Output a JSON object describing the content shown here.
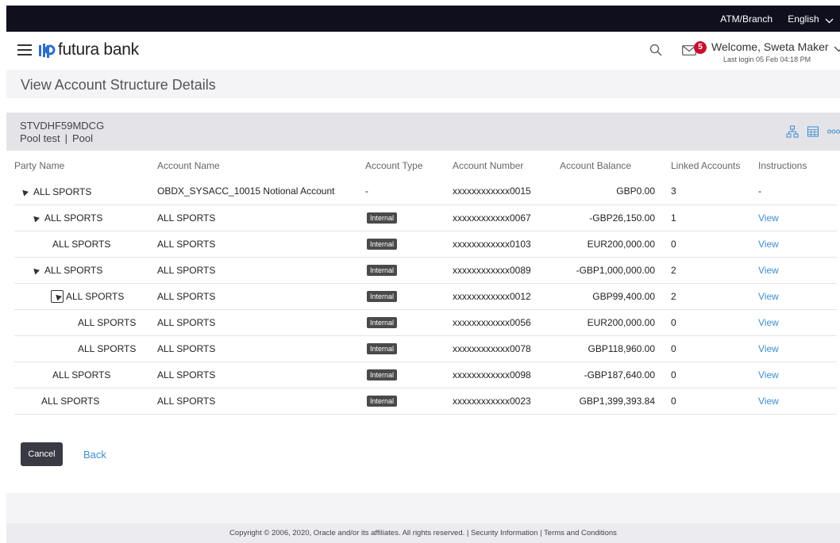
{
  "topbar": {
    "atm_branch": "ATM/Branch",
    "language": "English"
  },
  "header": {
    "logo_text": "futura bank",
    "notification_count": "5",
    "welcome": "Welcome, Sweta Maker",
    "last_login": "Last login 05 Feb 04:18 PM"
  },
  "page": {
    "title": "View Account Structure Details"
  },
  "structure": {
    "id": "STVDHF59MDCG",
    "name": "Pool test",
    "type": "Pool"
  },
  "columns": {
    "party": "Party Name",
    "account_name": "Account Name",
    "account_type": "Account Type",
    "account_number": "Account Number",
    "balance": "Account Balance",
    "linked": "Linked Accounts",
    "instructions": "Instructions"
  },
  "rows": [
    {
      "party": "ALL SPORTS",
      "account_name": "OBDX_SYSACC_10015 Notional Account",
      "type": "-",
      "number": "xxxxxxxxxxxx0015",
      "balance": "GBP0.00",
      "linked": "3",
      "instructions": "-"
    },
    {
      "party": "ALL SPORTS",
      "account_name": "ALL SPORTS",
      "type": "Internal",
      "number": "xxxxxxxxxxxx0067",
      "balance": "-GBP26,150.00",
      "linked": "1",
      "instructions": "View"
    },
    {
      "party": "ALL SPORTS",
      "account_name": "ALL SPORTS",
      "type": "Internal",
      "number": "xxxxxxxxxxxx0103",
      "balance": "EUR200,000.00",
      "linked": "0",
      "instructions": "View"
    },
    {
      "party": "ALL SPORTS",
      "account_name": "ALL SPORTS",
      "type": "Internal",
      "number": "xxxxxxxxxxxx0089",
      "balance": "-GBP1,000,000.00",
      "linked": "2",
      "instructions": "View"
    },
    {
      "party": "ALL SPORTS",
      "account_name": "ALL SPORTS",
      "type": "Internal",
      "number": "xxxxxxxxxxxx0012",
      "balance": "GBP99,400.00",
      "linked": "2",
      "instructions": "View"
    },
    {
      "party": "ALL SPORTS",
      "account_name": "ALL SPORTS",
      "type": "Internal",
      "number": "xxxxxxxxxxxx0056",
      "balance": "EUR200,000.00",
      "linked": "0",
      "instructions": "View"
    },
    {
      "party": "ALL SPORTS",
      "account_name": "ALL SPORTS",
      "type": "Internal",
      "number": "xxxxxxxxxxxx0078",
      "balance": "GBP118,960.00",
      "linked": "0",
      "instructions": "View"
    },
    {
      "party": "ALL SPORTS",
      "account_name": "ALL SPORTS",
      "type": "Internal",
      "number": "xxxxxxxxxxxx0098",
      "balance": "-GBP187,640.00",
      "linked": "0",
      "instructions": "View"
    },
    {
      "party": "ALL SPORTS",
      "account_name": "ALL SPORTS",
      "type": "Internal",
      "number": "xxxxxxxxxxxx0023",
      "balance": "GBP1,399,393.84",
      "linked": "0",
      "instructions": "View"
    }
  ],
  "actions": {
    "cancel": "Cancel",
    "back": "Back"
  },
  "footer": {
    "text": "Copyright © 2006, 2020, Oracle and/or its affiliates. All rights reserved. | Security Information | Terms and Conditions"
  },
  "colors": {
    "topbar": "#0f0f1e",
    "link": "#3e8ed0",
    "badge": "#c8102e",
    "cancel_button": "#3a3a45",
    "logo_accent": "#2e6fc9"
  }
}
